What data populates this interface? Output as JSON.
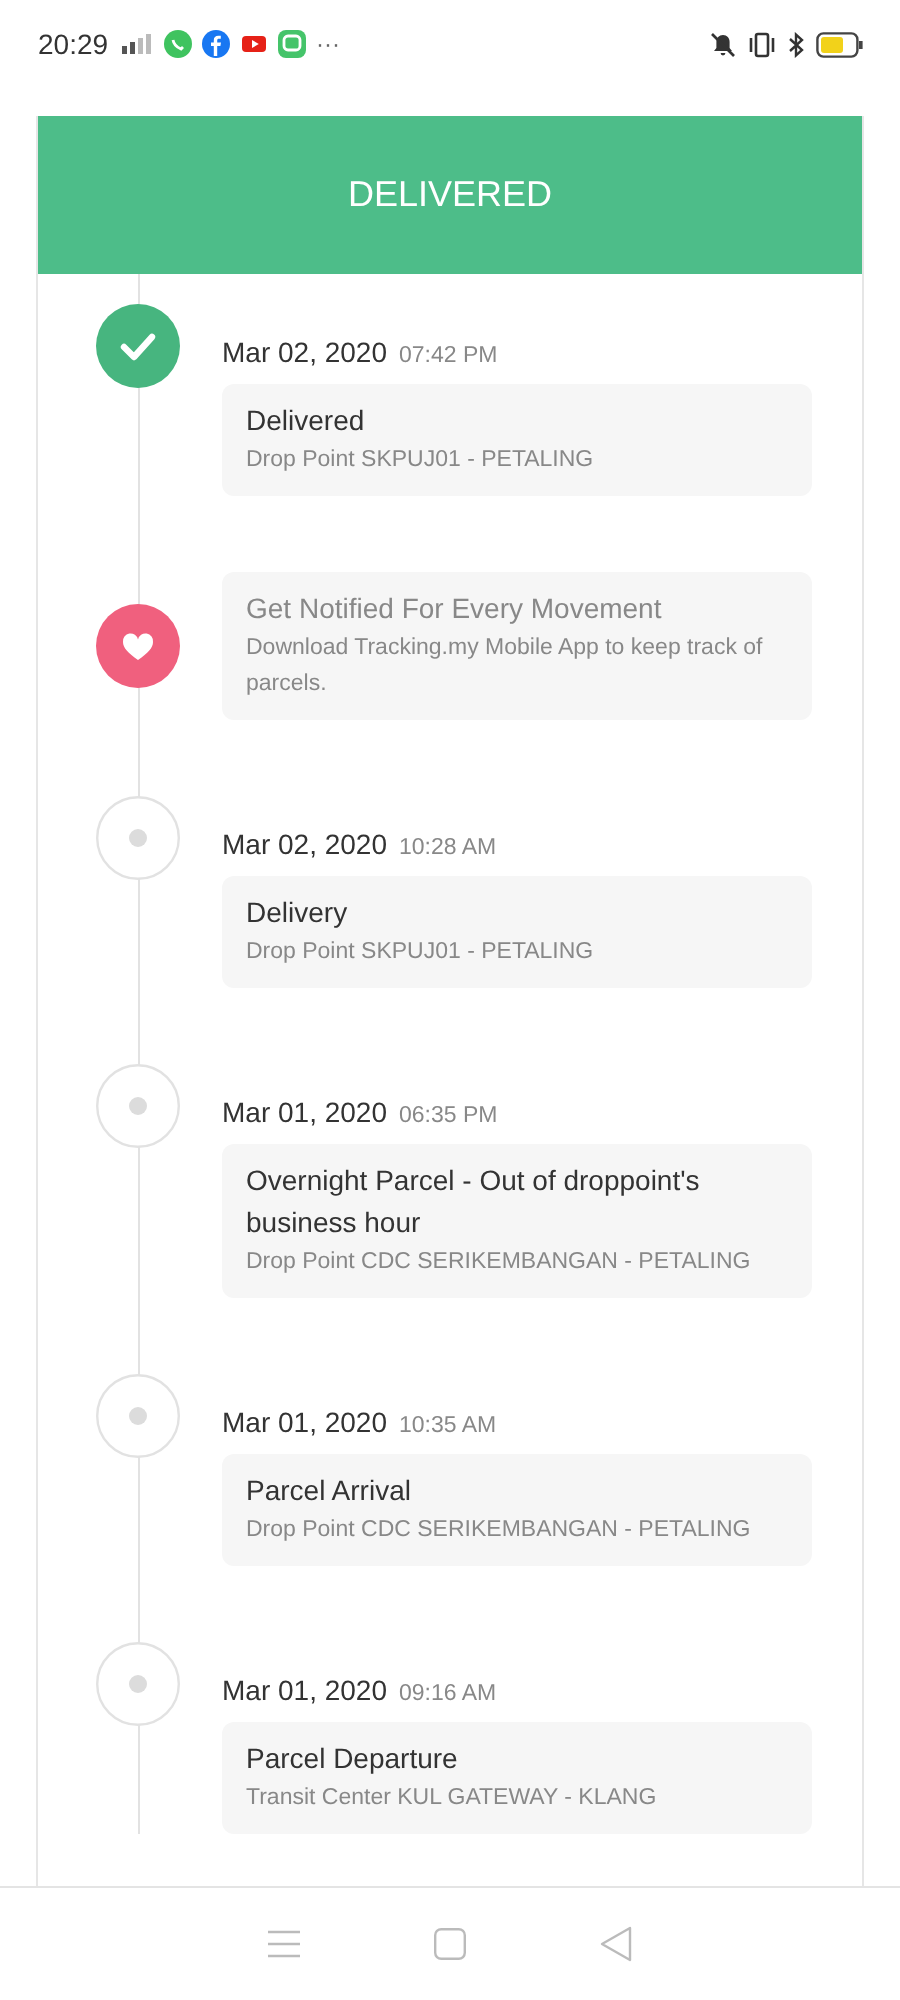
{
  "status_bar": {
    "time": "20:29",
    "more": "···"
  },
  "header": {
    "title": "DELIVERED"
  },
  "events": [
    {
      "kind": "delivered",
      "date": "Mar 02, 2020",
      "time": "07:42 PM",
      "title": "Delivered",
      "location": "Drop Point SKPUJ01 - PETALING"
    },
    {
      "kind": "promo",
      "title": "Get Notified For Every Movement",
      "location": "Download Tracking.my Mobile App to keep track of parcels."
    },
    {
      "kind": "event",
      "date": "Mar 02, 2020",
      "time": "10:28 AM",
      "title": "Delivery",
      "location": "Drop Point SKPUJ01 - PETALING"
    },
    {
      "kind": "event",
      "date": "Mar 01, 2020",
      "time": "06:35 PM",
      "title": "Overnight Parcel - Out of droppoint's business hour",
      "location": "Drop Point CDC SERIKEMBANGAN - PETALING"
    },
    {
      "kind": "event",
      "date": "Mar 01, 2020",
      "time": "10:35 AM",
      "title": "Parcel Arrival",
      "location": "Drop Point CDC SERIKEMBANGAN - PETALING"
    },
    {
      "kind": "event",
      "date": "Mar 01, 2020",
      "time": "09:16 AM",
      "title": "Parcel Departure",
      "location": "Transit Center KUL GATEWAY - KLANG"
    }
  ]
}
